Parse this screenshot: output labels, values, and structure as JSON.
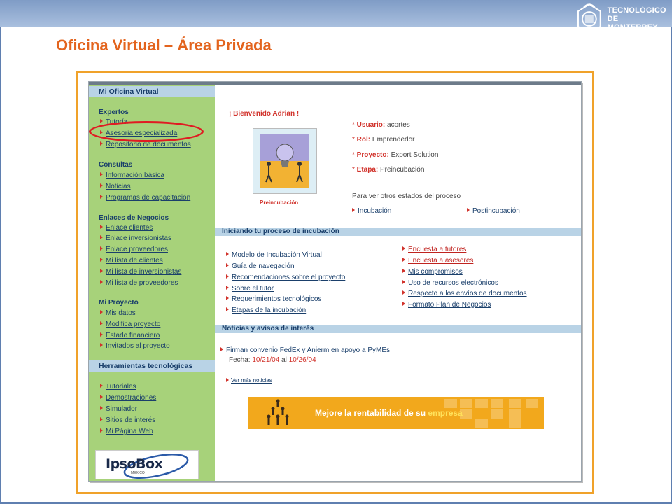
{
  "slide": {
    "title": "Oficina Virtual – Área Privada",
    "logo_line1": "TECNOLÓGICO",
    "logo_line2": "DE MONTERREY."
  },
  "sidebar": {
    "title": "Mi Oficina Virtual",
    "groups": [
      {
        "heading": "Expertos",
        "items": [
          "Tutoría",
          "Asesoria especializada",
          "Repositorio de documentos"
        ]
      },
      {
        "heading": "Consultas",
        "items": [
          "Información básica",
          "Noticias",
          "Programas de capacitación"
        ]
      },
      {
        "heading": "Enlaces de Negocios",
        "items": [
          "Enlace clientes",
          "Enlace inversionistas",
          "Enlace proveedores",
          "Mi lista de clientes",
          "Mi lista de inversionistas",
          "Mi lista de proveedores"
        ]
      },
      {
        "heading": "Mi Proyecto",
        "items": [
          "Mis datos",
          "Modifica proyecto",
          "Estado financiero",
          "Invitados al proyecto"
        ]
      }
    ],
    "tools_title": "Herramientas tecnológicas",
    "tools": [
      "Tutoriales",
      "Demostraciones",
      "Simulador",
      "Sitios de interés",
      "Mi Página Web"
    ],
    "sponsor_logo": "IpsoBox",
    "sponsor_sub": "MEXICO"
  },
  "main": {
    "welcome": "¡ Bienvenido Adrian !",
    "stage_label": "Preincubación",
    "info": [
      {
        "key": "Usuario:",
        "value": "acortes"
      },
      {
        "key": "Rol:",
        "value": "Emprendedor"
      },
      {
        "key": "Proyecto:",
        "value": "Export Solution"
      },
      {
        "key": "Etapa:",
        "value": "Preincubación"
      }
    ],
    "other_stages_note": "Para ver otros estados del proceso",
    "other_stages": [
      "Incubación",
      "Postincubación"
    ],
    "section_start": "Iniciando tu proceso de incubación",
    "start_left": [
      "Modelo de Incubación Virtual",
      "Guía de navegación",
      "Recomendaciones sobre el proyecto",
      "Sobre el tutor",
      "Requerimientos tecnológicos",
      "Etapas de la incubación"
    ],
    "start_right": [
      "Encuesta a tutores",
      "Encuesta a asesores",
      "Mis compromisos",
      "Uso de recursos electrónicos",
      "Respecto a los envíos de documentos",
      "Formato Plan de Negocios"
    ],
    "section_news": "Noticias y avisos de interés",
    "news_item": "Firman convenio FedEx y Anierm en apoyo a PyMEs",
    "news_date_label": "Fecha:",
    "news_date_from": "10/21/04",
    "news_date_sep": "al",
    "news_date_to": "10/26/04",
    "more_news": "Ver más noticias",
    "banner_text": "Mejore la rentabilidad de su",
    "banner_highlight": "empresa"
  }
}
